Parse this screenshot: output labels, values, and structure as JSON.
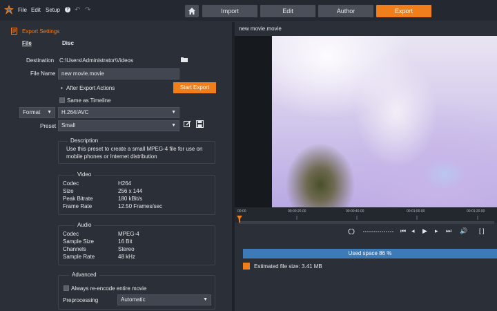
{
  "menu": {
    "file": "File",
    "edit": "Edit",
    "setup": "Setup",
    "help": "?"
  },
  "tabs": [
    {
      "label": "Import"
    },
    {
      "label": "Edit"
    },
    {
      "label": "Author"
    },
    {
      "label": "Export"
    }
  ],
  "export_settings": {
    "title": "Export Settings",
    "subtabs": [
      "File",
      "Disc"
    ],
    "destination_label": "Destination",
    "destination_value": "C:\\Users\\Administrator\\Videos",
    "filename_label": "File Name",
    "filename_value": "new movie.movie",
    "after_export": "After Export Actions",
    "start_export": "Start Export",
    "same_as_timeline": "Same as Timeline",
    "format_label": "Format",
    "format_value": "H.264/AVC",
    "preset_label": "Preset",
    "preset_value": "Small",
    "description_title": "Description",
    "description_text_1": "Use this preset to create a small MPEG-4 file for use on",
    "description_text_2": "mobile phones or Internet distribution",
    "video": {
      "title": "Video",
      "rows": [
        {
          "k": "Codec",
          "v": "H264"
        },
        {
          "k": "Size",
          "v": "256 x 144"
        },
        {
          "k": "Peak Bitrate",
          "v": "180 kBit/s"
        },
        {
          "k": "Frame Rate",
          "v": "12.50 Frames/sec"
        }
      ]
    },
    "audio": {
      "title": "Audio",
      "rows": [
        {
          "k": "Codec",
          "v": "MPEG-4"
        },
        {
          "k": "Sample Size",
          "v": "16 Bit"
        },
        {
          "k": "Channels",
          "v": "Stereo"
        },
        {
          "k": "Sample Rate",
          "v": "48 kHz"
        }
      ]
    },
    "advanced": {
      "title": "Advanced",
      "reencode": "Always re-encode entire movie",
      "preprocessing_label": "Preprocessing",
      "preprocessing_value": "Automatic"
    }
  },
  "preview": {
    "title": "new movie.movie",
    "ticks": [
      "00:00",
      "00:00:20.00",
      "00:00:40.00",
      "00:01:00.00",
      "00:01:20.00"
    ],
    "used_space": "Used space 86 %",
    "estimated_size": "Estimated file size: 3.41 MB"
  },
  "colors": {
    "accent": "#f07e1a",
    "used_bar": "#3d7ab8",
    "panel": "#2b2f37"
  }
}
